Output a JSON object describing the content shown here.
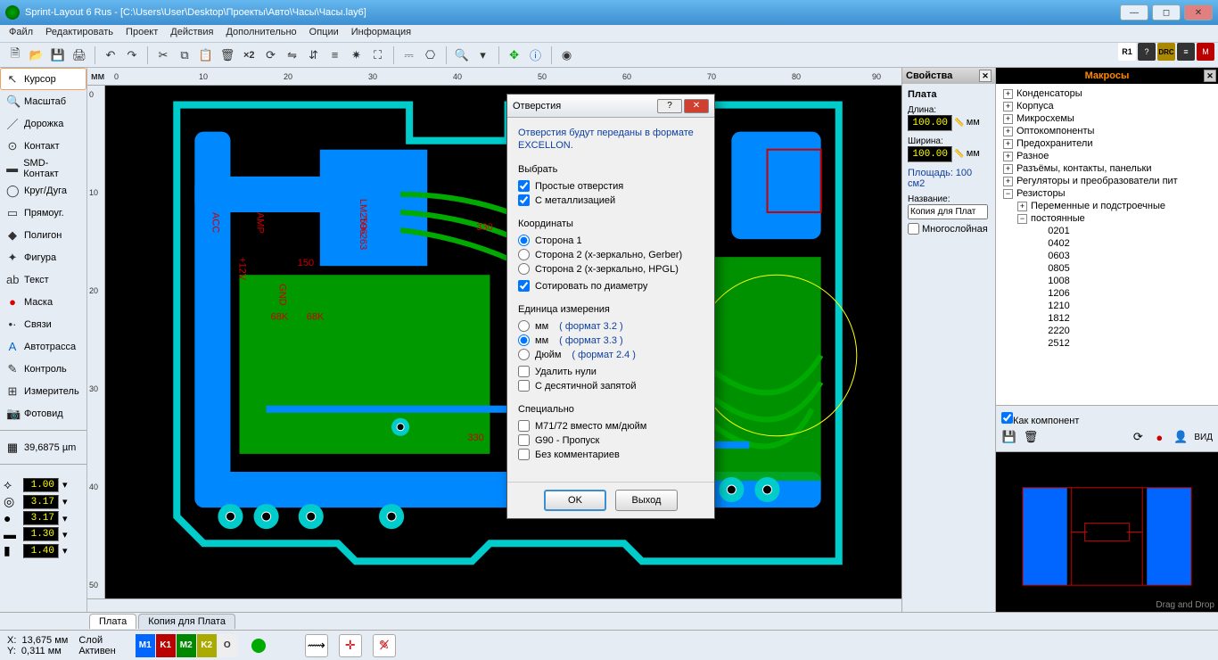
{
  "title": "Sprint-Layout 6 Rus - [C:\\Users\\User\\Desktop\\Проекты\\Авто\\Часы\\Часы.lay6]",
  "menu": [
    "Файл",
    "Редактировать",
    "Проект",
    "Действия",
    "Дополнительно",
    "Опции",
    "Информация"
  ],
  "tools": [
    {
      "icon": "↖",
      "label": "Курсор",
      "sel": true
    },
    {
      "icon": "🔍",
      "label": "Масштаб"
    },
    {
      "icon": "／",
      "label": "Дорожка"
    },
    {
      "icon": "⊙",
      "label": "Контакт"
    },
    {
      "icon": "▬",
      "label": "SMD-Контакт"
    },
    {
      "icon": "◯",
      "label": "Круг/Дуга"
    },
    {
      "icon": "▭",
      "label": "Прямоуг."
    },
    {
      "icon": "◆",
      "label": "Полигон"
    },
    {
      "icon": "✦",
      "label": "Фигура"
    },
    {
      "icon": "ab",
      "label": "Текст"
    },
    {
      "icon": "●",
      "label": "Маска",
      "iconcolor": "#d00"
    },
    {
      "icon": "•·",
      "label": "Связи"
    },
    {
      "icon": "A",
      "label": "Автотрасса",
      "iconcolor": "#06c"
    },
    {
      "icon": "✎",
      "label": "Контроль"
    },
    {
      "icon": "⊞",
      "label": "Измеритель"
    },
    {
      "icon": "📷",
      "label": "Фотовид"
    }
  ],
  "grid_label": "39,6875 µm",
  "params": {
    "p1": "1.00",
    "p2": "3.17",
    "p3": "3.17",
    "p4": "1.30",
    "p5": "1.40"
  },
  "hruler_unit": "мм",
  "hruler_ticks": [
    "0",
    "10",
    "20",
    "30",
    "40",
    "50",
    "60",
    "70",
    "80",
    "90"
  ],
  "vruler_ticks": [
    "0",
    "10",
    "20",
    "30",
    "40",
    "50"
  ],
  "tabs": [
    "Плата",
    "Копия для Плата"
  ],
  "active_tab": 0,
  "status": {
    "x_label": "X:",
    "x": "13,675 мм",
    "y_label": "Y:",
    "y": "0,311 мм",
    "layer_label": "Слой",
    "active_label": "Активен",
    "layers": [
      {
        "name": "M1",
        "color": "#06f"
      },
      {
        "name": "K1",
        "color": "#b00"
      },
      {
        "name": "М2",
        "color": "#080"
      },
      {
        "name": "K2",
        "color": "#aa0"
      },
      {
        "name": "O",
        "color": "#eee"
      }
    ]
  },
  "props": {
    "title": "Свойства",
    "head": "Плата",
    "length_label": "Длина:",
    "length": "100.00",
    "length_unit": "мм",
    "width_label": "Ширина:",
    "width": "100.00",
    "width_unit": "мм",
    "area_label": "Площадь:",
    "area_value": "100 см2",
    "name_label": "Название:",
    "name_value": "Копия для Плат",
    "multilayer": "Многослойная"
  },
  "macros": {
    "title": "Макросы",
    "foot_check": "Как компонент",
    "view_label": "ВИД",
    "dnd": "Drag and Drop",
    "tree": [
      {
        "l": "Конденсаторы",
        "exp": "+"
      },
      {
        "l": "Корпуса",
        "exp": "+"
      },
      {
        "l": "Микросхемы",
        "exp": "+"
      },
      {
        "l": "Оптокомпоненты",
        "exp": "+"
      },
      {
        "l": "Предохранители",
        "exp": "+"
      },
      {
        "l": "Разное",
        "exp": "+"
      },
      {
        "l": "Разъёмы, контакты, панельки",
        "exp": "+"
      },
      {
        "l": "Регуляторы и преобразователи пит",
        "exp": "+"
      },
      {
        "l": "Резисторы",
        "exp": "−",
        "children": [
          {
            "l": "Переменные и подстроечные",
            "exp": "+"
          },
          {
            "l": "постоянные",
            "exp": "−",
            "children": [
              {
                "l": "0201"
              },
              {
                "l": "0402"
              },
              {
                "l": "0603"
              },
              {
                "l": "0805"
              },
              {
                "l": "1008"
              },
              {
                "l": "1206"
              },
              {
                "l": "1210"
              },
              {
                "l": "1812"
              },
              {
                "l": "2220"
              },
              {
                "l": "2512"
              }
            ]
          }
        ]
      }
    ]
  },
  "dialog": {
    "title": "Отверстия",
    "info": "Отверстия будут переданы в формате EXCELLON.",
    "g_select": "Выбрать",
    "c_simple": "Простые отверстия",
    "c_metal": "С металлизацией",
    "g_coord": "Координаты",
    "r_side1": "Сторона 1",
    "r_side2g": "Сторона 2 (x-зеркально, Gerber)",
    "r_side2h": "Сторона 2 (x-зеркально, HPGL)",
    "c_sort": "Сотировать по диаметру",
    "g_unit": "Единица измерения",
    "r_mm1": "мм",
    "f_mm1": "( формат 3.2 )",
    "r_mm2": "мм",
    "f_mm2": "( формат 3.3 )",
    "r_inch": "Дюйм",
    "f_inch": "( формат 2.4 )",
    "c_delzero": "Удалить нули",
    "c_decimal": "С десятичной запятой",
    "g_special": "Специально",
    "c_m71": "M71/72 вместо мм/дюйм",
    "c_g90": "G90 - Пропуск",
    "c_nocomm": "Без комментариев",
    "btn_ok": "OK",
    "btn_exit": "Выход"
  }
}
